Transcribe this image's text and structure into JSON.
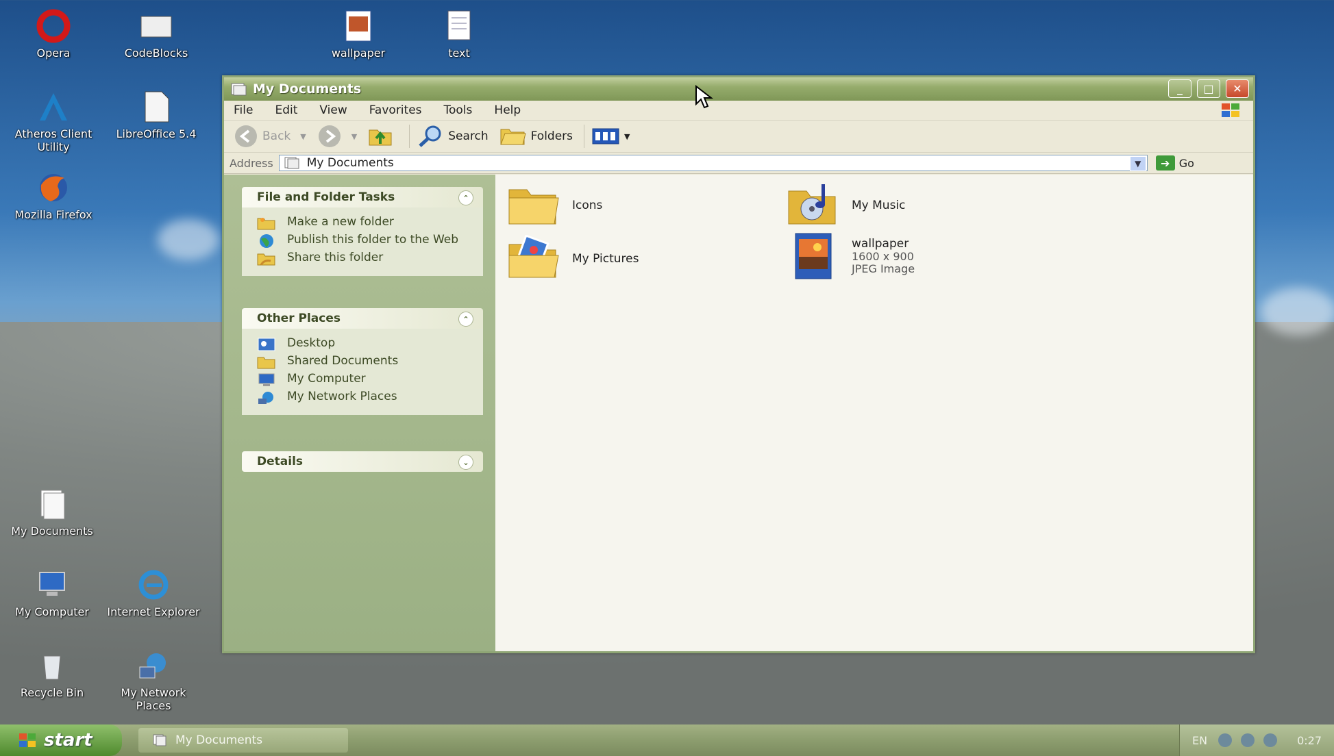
{
  "desktop": {
    "icons": [
      {
        "label": "Opera",
        "icon": "opera-icon"
      },
      {
        "label": "CodeBlocks",
        "icon": "codeblocks-icon"
      },
      {
        "label": "wallpaper",
        "icon": "image-file-icon"
      },
      {
        "label": "text",
        "icon": "text-file-icon"
      },
      {
        "label": "Atheros Client Utility",
        "icon": "atheros-icon"
      },
      {
        "label": "LibreOffice 5.4",
        "icon": "libreoffice-icon"
      },
      {
        "label": "Mozilla Firefox",
        "icon": "firefox-icon"
      },
      {
        "label": "My Documents",
        "icon": "my-documents-icon"
      },
      {
        "label": "My Computer",
        "icon": "my-computer-icon"
      },
      {
        "label": "Internet Explorer",
        "icon": "internet-explorer-icon"
      },
      {
        "label": "Recycle Bin",
        "icon": "recycle-bin-icon"
      },
      {
        "label": "My Network Places",
        "icon": "network-places-icon"
      }
    ]
  },
  "window": {
    "title": "My Documents",
    "controls": {
      "minimize": "_",
      "maximize": "□",
      "close": "✕"
    },
    "menu": [
      "File",
      "Edit",
      "View",
      "Favorites",
      "Tools",
      "Help"
    ],
    "toolbar": {
      "back": "Back",
      "search": "Search",
      "folders": "Folders"
    },
    "address": {
      "label": "Address",
      "value": "My Documents",
      "go": "Go"
    },
    "tasks": {
      "file_folder": {
        "title": "File and Folder Tasks",
        "items": [
          "Make a new folder",
          "Publish this folder to the Web",
          "Share this folder"
        ]
      },
      "other_places": {
        "title": "Other Places",
        "items": [
          "Desktop",
          "Shared Documents",
          "My Computer",
          "My Network Places"
        ]
      },
      "details": {
        "title": "Details"
      }
    },
    "files": [
      {
        "name": "Icons",
        "icon": "folder-icon"
      },
      {
        "name": "My Music",
        "icon": "music-folder-icon"
      },
      {
        "name": "My Pictures",
        "icon": "pictures-folder-icon"
      },
      {
        "name": "wallpaper",
        "line2": "1600 x 900",
        "line3": "JPEG Image",
        "icon": "jpeg-icon"
      }
    ]
  },
  "taskbar": {
    "start": "start",
    "active_task": "My Documents",
    "tray": {
      "lang": "EN",
      "clock": "0:27"
    }
  },
  "colors": {
    "accent": "#8fa675",
    "taskbar": "#8c9d6e",
    "close": "#c6482a"
  }
}
